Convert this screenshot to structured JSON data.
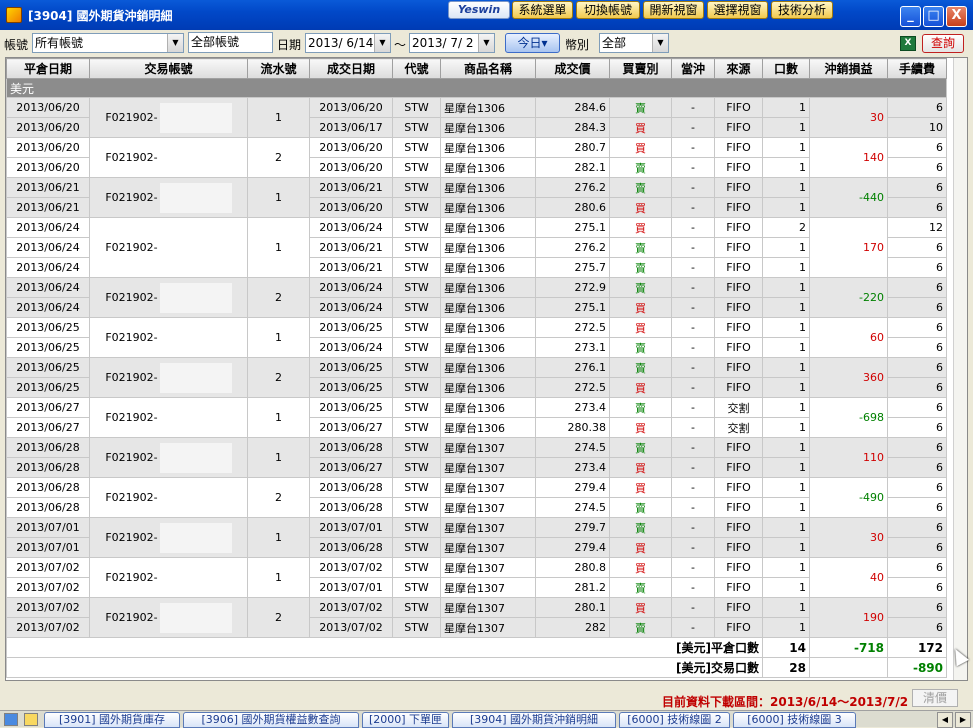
{
  "window": {
    "title": "[3904] 國外期貨沖銷明細",
    "logo": "Yeswin",
    "menu": [
      "系統選單",
      "切換帳號",
      "開新視窗",
      "選擇視窗",
      "技術分析"
    ],
    "controls": {
      "minimize": "_",
      "maximize": "□",
      "close": "X"
    }
  },
  "toolbar": {
    "account_label": "帳號",
    "account_value": "所有帳號",
    "account_box": "全部帳號",
    "date_label": "日期",
    "date_from": "2013/ 6/14",
    "date_sep": "～",
    "date_to": "2013/ 7/ 2",
    "today_button": "今日▾",
    "currency_label": "幣別",
    "currency_value": "全部",
    "excel_icon": "X",
    "query_button": "查詢"
  },
  "table": {
    "headers": [
      "平倉日期",
      "交易帳號",
      "流水號",
      "成交日期",
      "代號",
      "商品名稱",
      "成交價",
      "買賣別",
      "當沖",
      "來源",
      "口數",
      "沖銷損益",
      "手續費"
    ],
    "group_label": "美元",
    "groups": [
      {
        "account": "F021902-",
        "serial": "1",
        "pl": "30",
        "pl_sign": "pos",
        "rows": [
          {
            "close_date": "2013/06/20",
            "trade_date": "2013/06/20",
            "code": "STW",
            "product": "星摩台1306",
            "price": "284.6",
            "side": "賣",
            "daytrade": "-",
            "source": "FIFO",
            "qty": "1",
            "fee": "6"
          },
          {
            "close_date": "2013/06/20",
            "trade_date": "2013/06/17",
            "code": "STW",
            "product": "星摩台1306",
            "price": "284.3",
            "side": "買",
            "daytrade": "-",
            "source": "FIFO",
            "qty": "1",
            "fee": "10"
          }
        ]
      },
      {
        "account": "F021902-",
        "serial": "2",
        "pl": "140",
        "pl_sign": "pos",
        "rows": [
          {
            "close_date": "2013/06/20",
            "trade_date": "2013/06/20",
            "code": "STW",
            "product": "星摩台1306",
            "price": "280.7",
            "side": "買",
            "daytrade": "-",
            "source": "FIFO",
            "qty": "1",
            "fee": "6"
          },
          {
            "close_date": "2013/06/20",
            "trade_date": "2013/06/20",
            "code": "STW",
            "product": "星摩台1306",
            "price": "282.1",
            "side": "賣",
            "daytrade": "-",
            "source": "FIFO",
            "qty": "1",
            "fee": "6"
          }
        ]
      },
      {
        "account": "F021902-",
        "serial": "1",
        "pl": "-440",
        "pl_sign": "neg",
        "rows": [
          {
            "close_date": "2013/06/21",
            "trade_date": "2013/06/21",
            "code": "STW",
            "product": "星摩台1306",
            "price": "276.2",
            "side": "賣",
            "daytrade": "-",
            "source": "FIFO",
            "qty": "1",
            "fee": "6"
          },
          {
            "close_date": "2013/06/21",
            "trade_date": "2013/06/20",
            "code": "STW",
            "product": "星摩台1306",
            "price": "280.6",
            "side": "買",
            "daytrade": "-",
            "source": "FIFO",
            "qty": "1",
            "fee": "6"
          }
        ]
      },
      {
        "account": "F021902-",
        "serial": "1",
        "pl": "170",
        "pl_sign": "pos",
        "rows": [
          {
            "close_date": "2013/06/24",
            "trade_date": "2013/06/24",
            "code": "STW",
            "product": "星摩台1306",
            "price": "275.1",
            "side": "買",
            "daytrade": "-",
            "source": "FIFO",
            "qty": "2",
            "fee": "12"
          },
          {
            "close_date": "2013/06/24",
            "trade_date": "2013/06/21",
            "code": "STW",
            "product": "星摩台1306",
            "price": "276.2",
            "side": "賣",
            "daytrade": "-",
            "source": "FIFO",
            "qty": "1",
            "fee": "6"
          },
          {
            "close_date": "2013/06/24",
            "trade_date": "2013/06/21",
            "code": "STW",
            "product": "星摩台1306",
            "price": "275.7",
            "side": "賣",
            "daytrade": "-",
            "source": "FIFO",
            "qty": "1",
            "fee": "6"
          }
        ]
      },
      {
        "account": "F021902-",
        "serial": "2",
        "pl": "-220",
        "pl_sign": "neg",
        "rows": [
          {
            "close_date": "2013/06/24",
            "trade_date": "2013/06/24",
            "code": "STW",
            "product": "星摩台1306",
            "price": "272.9",
            "side": "賣",
            "daytrade": "-",
            "source": "FIFO",
            "qty": "1",
            "fee": "6"
          },
          {
            "close_date": "2013/06/24",
            "trade_date": "2013/06/24",
            "code": "STW",
            "product": "星摩台1306",
            "price": "275.1",
            "side": "買",
            "daytrade": "-",
            "source": "FIFO",
            "qty": "1",
            "fee": "6"
          }
        ]
      },
      {
        "account": "F021902-",
        "serial": "1",
        "pl": "60",
        "pl_sign": "pos",
        "rows": [
          {
            "close_date": "2013/06/25",
            "trade_date": "2013/06/25",
            "code": "STW",
            "product": "星摩台1306",
            "price": "272.5",
            "side": "買",
            "daytrade": "-",
            "source": "FIFO",
            "qty": "1",
            "fee": "6"
          },
          {
            "close_date": "2013/06/25",
            "trade_date": "2013/06/24",
            "code": "STW",
            "product": "星摩台1306",
            "price": "273.1",
            "side": "賣",
            "daytrade": "-",
            "source": "FIFO",
            "qty": "1",
            "fee": "6"
          }
        ]
      },
      {
        "account": "F021902-",
        "serial": "2",
        "pl": "360",
        "pl_sign": "pos",
        "rows": [
          {
            "close_date": "2013/06/25",
            "trade_date": "2013/06/25",
            "code": "STW",
            "product": "星摩台1306",
            "price": "276.1",
            "side": "賣",
            "daytrade": "-",
            "source": "FIFO",
            "qty": "1",
            "fee": "6"
          },
          {
            "close_date": "2013/06/25",
            "trade_date": "2013/06/25",
            "code": "STW",
            "product": "星摩台1306",
            "price": "272.5",
            "side": "買",
            "daytrade": "-",
            "source": "FIFO",
            "qty": "1",
            "fee": "6"
          }
        ]
      },
      {
        "account": "F021902-",
        "serial": "1",
        "pl": "-698",
        "pl_sign": "neg",
        "rows": [
          {
            "close_date": "2013/06/27",
            "trade_date": "2013/06/25",
            "code": "STW",
            "product": "星摩台1306",
            "price": "273.4",
            "side": "賣",
            "daytrade": "-",
            "source": "交割",
            "qty": "1",
            "fee": "6"
          },
          {
            "close_date": "2013/06/27",
            "trade_date": "2013/06/27",
            "code": "STW",
            "product": "星摩台1306",
            "price": "280.38",
            "side": "買",
            "daytrade": "-",
            "source": "交割",
            "qty": "1",
            "fee": "6"
          }
        ]
      },
      {
        "account": "F021902-",
        "serial": "1",
        "pl": "110",
        "pl_sign": "pos",
        "rows": [
          {
            "close_date": "2013/06/28",
            "trade_date": "2013/06/28",
            "code": "STW",
            "product": "星摩台1307",
            "price": "274.5",
            "side": "賣",
            "daytrade": "-",
            "source": "FIFO",
            "qty": "1",
            "fee": "6"
          },
          {
            "close_date": "2013/06/28",
            "trade_date": "2013/06/27",
            "code": "STW",
            "product": "星摩台1307",
            "price": "273.4",
            "side": "買",
            "daytrade": "-",
            "source": "FIFO",
            "qty": "1",
            "fee": "6"
          }
        ]
      },
      {
        "account": "F021902-",
        "serial": "2",
        "pl": "-490",
        "pl_sign": "neg",
        "rows": [
          {
            "close_date": "2013/06/28",
            "trade_date": "2013/06/28",
            "code": "STW",
            "product": "星摩台1307",
            "price": "279.4",
            "side": "買",
            "daytrade": "-",
            "source": "FIFO",
            "qty": "1",
            "fee": "6"
          },
          {
            "close_date": "2013/06/28",
            "trade_date": "2013/06/28",
            "code": "STW",
            "product": "星摩台1307",
            "price": "274.5",
            "side": "賣",
            "daytrade": "-",
            "source": "FIFO",
            "qty": "1",
            "fee": "6"
          }
        ]
      },
      {
        "account": "F021902-",
        "serial": "1",
        "pl": "30",
        "pl_sign": "pos",
        "rows": [
          {
            "close_date": "2013/07/01",
            "trade_date": "2013/07/01",
            "code": "STW",
            "product": "星摩台1307",
            "price": "279.7",
            "side": "賣",
            "daytrade": "-",
            "source": "FIFO",
            "qty": "1",
            "fee": "6"
          },
          {
            "close_date": "2013/07/01",
            "trade_date": "2013/06/28",
            "code": "STW",
            "product": "星摩台1307",
            "price": "279.4",
            "side": "買",
            "daytrade": "-",
            "source": "FIFO",
            "qty": "1",
            "fee": "6"
          }
        ]
      },
      {
        "account": "F021902-",
        "serial": "1",
        "pl": "40",
        "pl_sign": "pos",
        "rows": [
          {
            "close_date": "2013/07/02",
            "trade_date": "2013/07/02",
            "code": "STW",
            "product": "星摩台1307",
            "price": "280.8",
            "side": "買",
            "daytrade": "-",
            "source": "FIFO",
            "qty": "1",
            "fee": "6"
          },
          {
            "close_date": "2013/07/02",
            "trade_date": "2013/07/01",
            "code": "STW",
            "product": "星摩台1307",
            "price": "281.2",
            "side": "賣",
            "daytrade": "-",
            "source": "FIFO",
            "qty": "1",
            "fee": "6"
          }
        ]
      },
      {
        "account": "F021902-",
        "serial": "2",
        "pl": "190",
        "pl_sign": "pos",
        "rows": [
          {
            "close_date": "2013/07/02",
            "trade_date": "2013/07/02",
            "code": "STW",
            "product": "星摩台1307",
            "price": "280.1",
            "side": "買",
            "daytrade": "-",
            "source": "FIFO",
            "qty": "1",
            "fee": "6"
          },
          {
            "close_date": "2013/07/02",
            "trade_date": "2013/07/02",
            "code": "STW",
            "product": "星摩台1307",
            "price": "282",
            "side": "賣",
            "daytrade": "-",
            "source": "FIFO",
            "qty": "1",
            "fee": "6"
          }
        ]
      }
    ],
    "summary": [
      {
        "label": "[美元]平倉口數",
        "qty": "14",
        "pl": "-718",
        "fee": "172"
      },
      {
        "label": "[美元]交易口數",
        "qty": "28",
        "pl": "",
        "fee": "-890"
      }
    ]
  },
  "status": {
    "download_range": "目前資料下載區間：2013/6/14～2013/7/2",
    "clear_button": "清價"
  },
  "taskbar": {
    "tasks": [
      "[3901] 國外期貨庫存",
      "[3906] 國外期貨權益數查詢",
      "[2000] 下單匣",
      "[3904] 國外期貨沖銷明細",
      "[6000] 技術線圖 2",
      "[6000] 技術線圖 3"
    ],
    "nav": [
      "◀",
      "▶"
    ]
  },
  "colors": {
    "buy": "#d00000",
    "sell": "#008000",
    "title_bar": "#0148c8",
    "status_text": "#c00000"
  }
}
